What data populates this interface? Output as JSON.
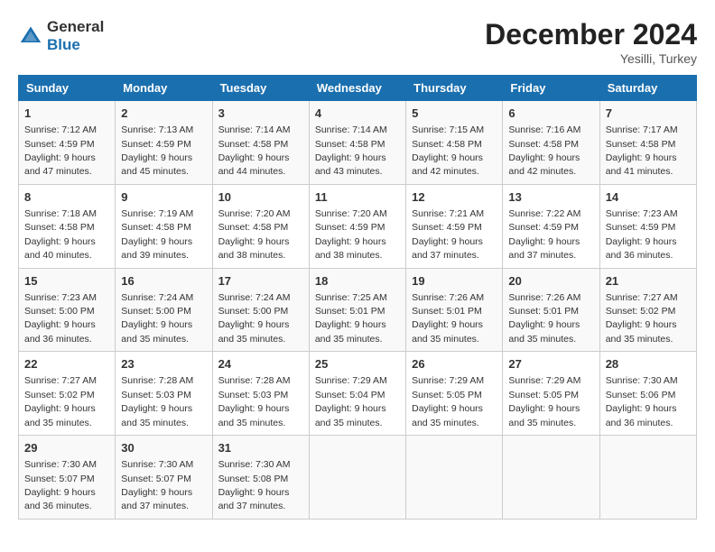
{
  "logo": {
    "general": "General",
    "blue": "Blue"
  },
  "title": "December 2024",
  "location": "Yesilli, Turkey",
  "days_of_week": [
    "Sunday",
    "Monday",
    "Tuesday",
    "Wednesday",
    "Thursday",
    "Friday",
    "Saturday"
  ],
  "weeks": [
    [
      {
        "day": "1",
        "info": "Sunrise: 7:12 AM\nSunset: 4:59 PM\nDaylight: 9 hours\nand 47 minutes."
      },
      {
        "day": "2",
        "info": "Sunrise: 7:13 AM\nSunset: 4:59 PM\nDaylight: 9 hours\nand 45 minutes."
      },
      {
        "day": "3",
        "info": "Sunrise: 7:14 AM\nSunset: 4:58 PM\nDaylight: 9 hours\nand 44 minutes."
      },
      {
        "day": "4",
        "info": "Sunrise: 7:14 AM\nSunset: 4:58 PM\nDaylight: 9 hours\nand 43 minutes."
      },
      {
        "day": "5",
        "info": "Sunrise: 7:15 AM\nSunset: 4:58 PM\nDaylight: 9 hours\nand 42 minutes."
      },
      {
        "day": "6",
        "info": "Sunrise: 7:16 AM\nSunset: 4:58 PM\nDaylight: 9 hours\nand 42 minutes."
      },
      {
        "day": "7",
        "info": "Sunrise: 7:17 AM\nSunset: 4:58 PM\nDaylight: 9 hours\nand 41 minutes."
      }
    ],
    [
      {
        "day": "8",
        "info": "Sunrise: 7:18 AM\nSunset: 4:58 PM\nDaylight: 9 hours\nand 40 minutes."
      },
      {
        "day": "9",
        "info": "Sunrise: 7:19 AM\nSunset: 4:58 PM\nDaylight: 9 hours\nand 39 minutes."
      },
      {
        "day": "10",
        "info": "Sunrise: 7:20 AM\nSunset: 4:58 PM\nDaylight: 9 hours\nand 38 minutes."
      },
      {
        "day": "11",
        "info": "Sunrise: 7:20 AM\nSunset: 4:59 PM\nDaylight: 9 hours\nand 38 minutes."
      },
      {
        "day": "12",
        "info": "Sunrise: 7:21 AM\nSunset: 4:59 PM\nDaylight: 9 hours\nand 37 minutes."
      },
      {
        "day": "13",
        "info": "Sunrise: 7:22 AM\nSunset: 4:59 PM\nDaylight: 9 hours\nand 37 minutes."
      },
      {
        "day": "14",
        "info": "Sunrise: 7:23 AM\nSunset: 4:59 PM\nDaylight: 9 hours\nand 36 minutes."
      }
    ],
    [
      {
        "day": "15",
        "info": "Sunrise: 7:23 AM\nSunset: 5:00 PM\nDaylight: 9 hours\nand 36 minutes."
      },
      {
        "day": "16",
        "info": "Sunrise: 7:24 AM\nSunset: 5:00 PM\nDaylight: 9 hours\nand 35 minutes."
      },
      {
        "day": "17",
        "info": "Sunrise: 7:24 AM\nSunset: 5:00 PM\nDaylight: 9 hours\nand 35 minutes."
      },
      {
        "day": "18",
        "info": "Sunrise: 7:25 AM\nSunset: 5:01 PM\nDaylight: 9 hours\nand 35 minutes."
      },
      {
        "day": "19",
        "info": "Sunrise: 7:26 AM\nSunset: 5:01 PM\nDaylight: 9 hours\nand 35 minutes."
      },
      {
        "day": "20",
        "info": "Sunrise: 7:26 AM\nSunset: 5:01 PM\nDaylight: 9 hours\nand 35 minutes."
      },
      {
        "day": "21",
        "info": "Sunrise: 7:27 AM\nSunset: 5:02 PM\nDaylight: 9 hours\nand 35 minutes."
      }
    ],
    [
      {
        "day": "22",
        "info": "Sunrise: 7:27 AM\nSunset: 5:02 PM\nDaylight: 9 hours\nand 35 minutes."
      },
      {
        "day": "23",
        "info": "Sunrise: 7:28 AM\nSunset: 5:03 PM\nDaylight: 9 hours\nand 35 minutes."
      },
      {
        "day": "24",
        "info": "Sunrise: 7:28 AM\nSunset: 5:03 PM\nDaylight: 9 hours\nand 35 minutes."
      },
      {
        "day": "25",
        "info": "Sunrise: 7:29 AM\nSunset: 5:04 PM\nDaylight: 9 hours\nand 35 minutes."
      },
      {
        "day": "26",
        "info": "Sunrise: 7:29 AM\nSunset: 5:05 PM\nDaylight: 9 hours\nand 35 minutes."
      },
      {
        "day": "27",
        "info": "Sunrise: 7:29 AM\nSunset: 5:05 PM\nDaylight: 9 hours\nand 35 minutes."
      },
      {
        "day": "28",
        "info": "Sunrise: 7:30 AM\nSunset: 5:06 PM\nDaylight: 9 hours\nand 36 minutes."
      }
    ],
    [
      {
        "day": "29",
        "info": "Sunrise: 7:30 AM\nSunset: 5:07 PM\nDaylight: 9 hours\nand 36 minutes."
      },
      {
        "day": "30",
        "info": "Sunrise: 7:30 AM\nSunset: 5:07 PM\nDaylight: 9 hours\nand 37 minutes."
      },
      {
        "day": "31",
        "info": "Sunrise: 7:30 AM\nSunset: 5:08 PM\nDaylight: 9 hours\nand 37 minutes."
      },
      null,
      null,
      null,
      null
    ]
  ]
}
